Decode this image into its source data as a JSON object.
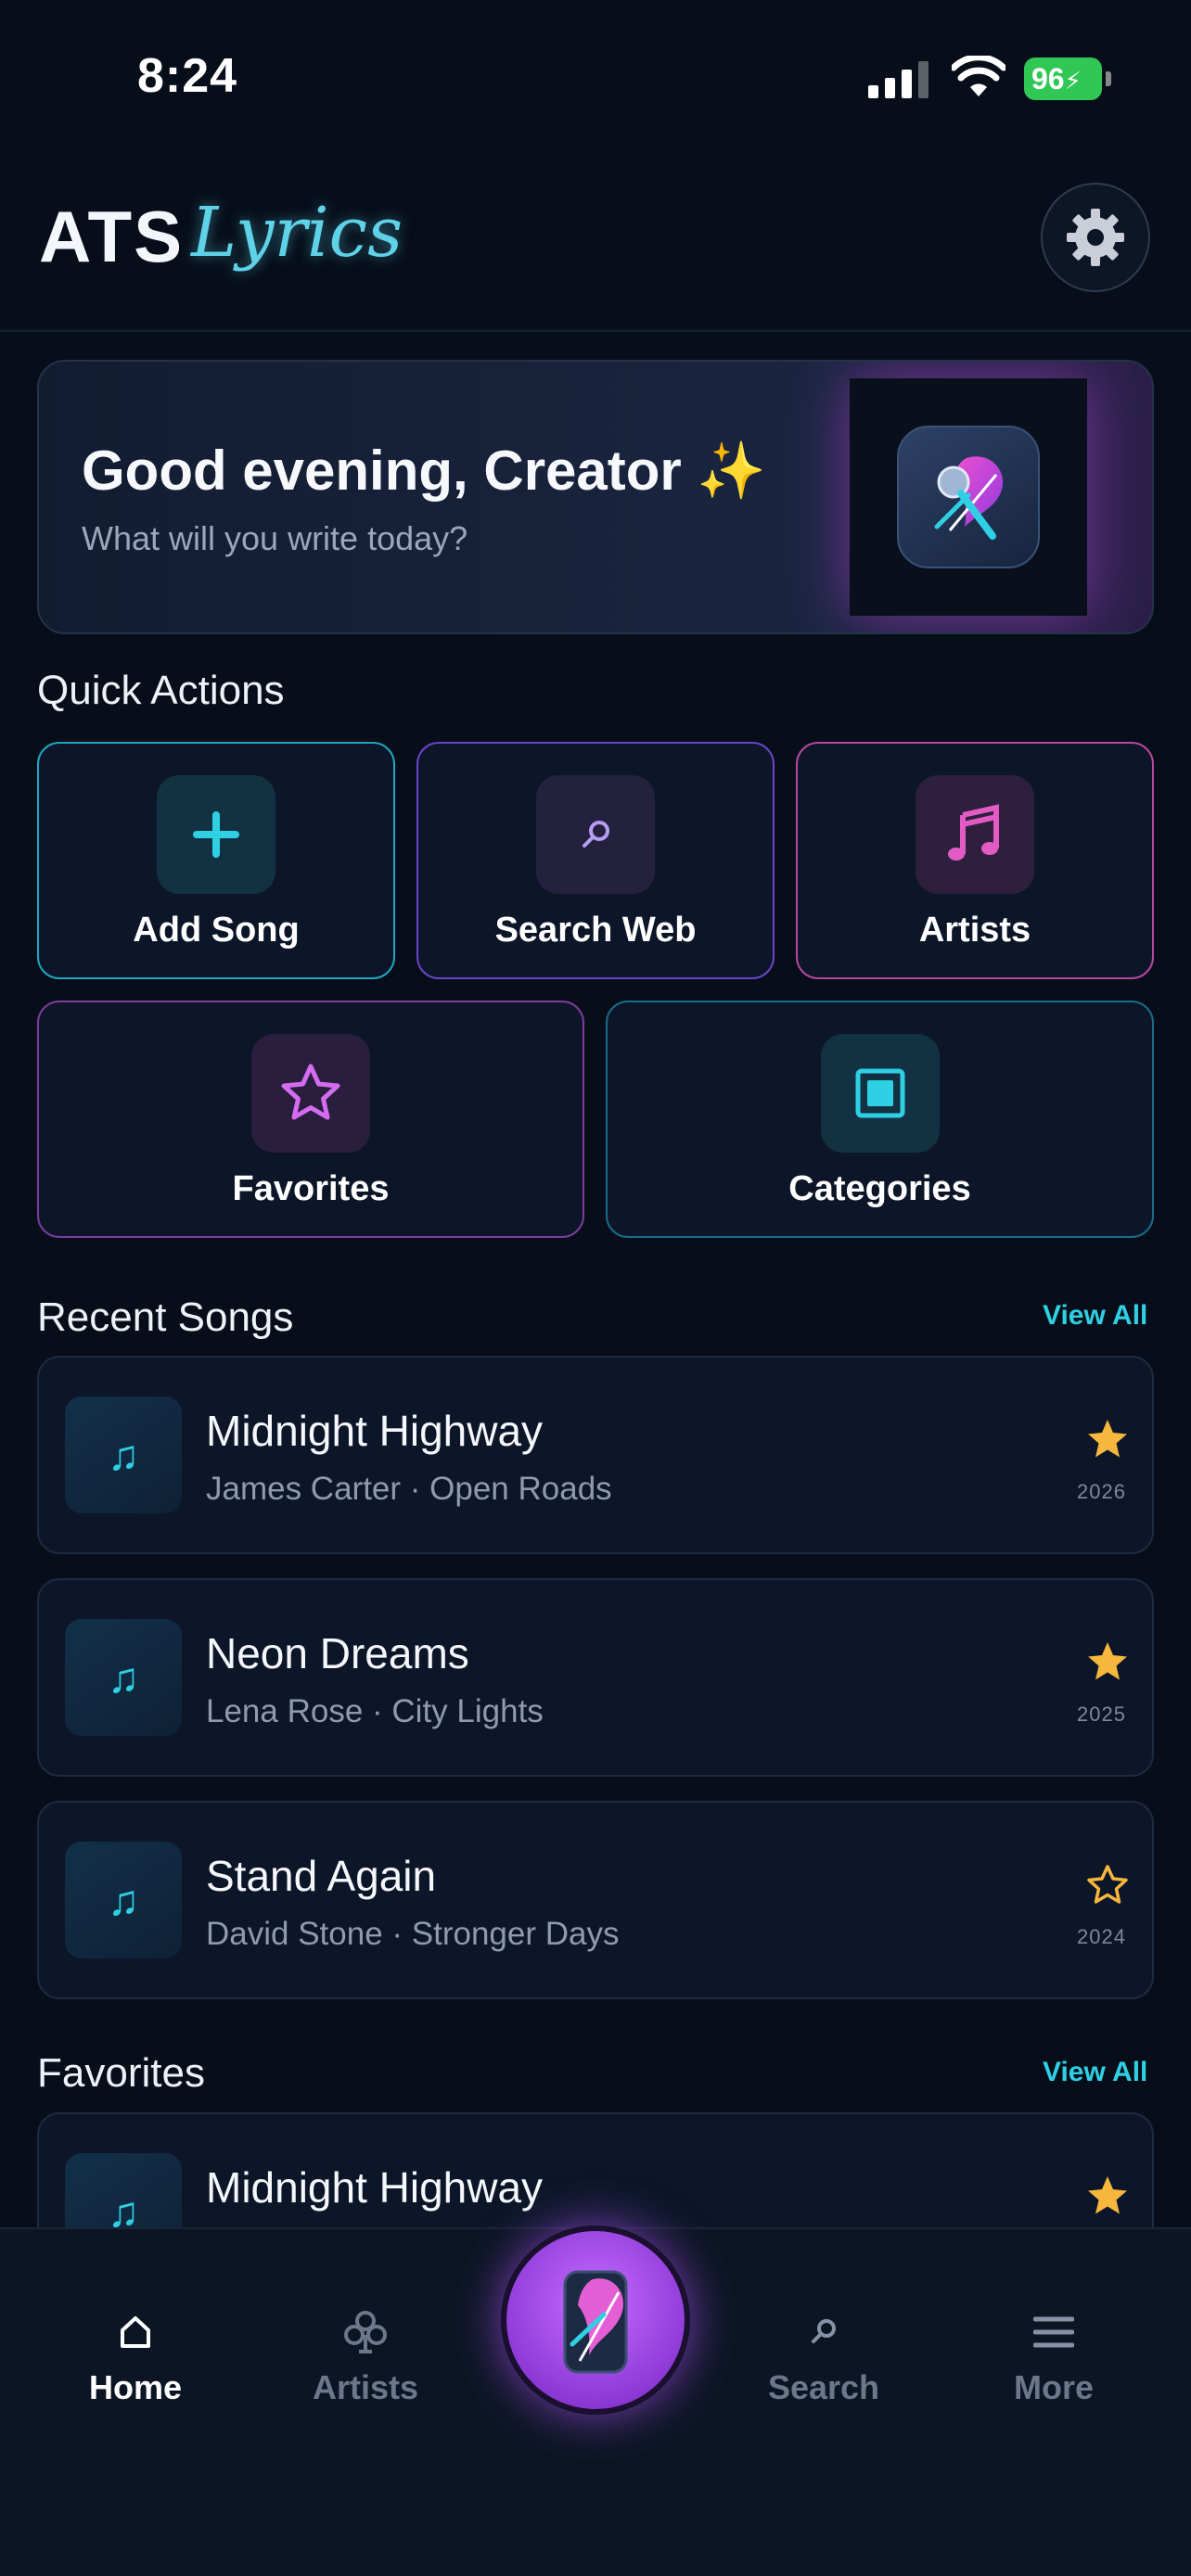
{
  "status_bar": {
    "time": "8:24",
    "battery": "96"
  },
  "header": {
    "logo_main": "ATS",
    "logo_script": "Lyrics"
  },
  "greeting": {
    "title": "Good evening, Creator ✨",
    "subtitle": "What will you write today?"
  },
  "quick_actions": {
    "title": "Quick Actions",
    "items": [
      {
        "label": "Add Song",
        "icon": "plus-icon",
        "color": "#2fd0e4"
      },
      {
        "label": "Search Web",
        "icon": "search-icon",
        "color": "#8b5cf6"
      },
      {
        "label": "Artists",
        "icon": "music-note-icon",
        "color": "#e25bc4"
      },
      {
        "label": "Favorites",
        "icon": "star-icon",
        "color": "#b45fe0"
      },
      {
        "label": "Categories",
        "icon": "square-icon",
        "color": "#2fb6d6"
      }
    ]
  },
  "recent_songs": {
    "title": "Recent Songs",
    "view_all": "View All",
    "items": [
      {
        "title": "Midnight Highway",
        "subtitle": "James Carter · Open Roads",
        "year": "2026",
        "favorite": true
      },
      {
        "title": "Neon Dreams",
        "subtitle": "Lena Rose · City Lights",
        "year": "2025",
        "favorite": true
      },
      {
        "title": "Stand Again",
        "subtitle": "David Stone · Stronger Days",
        "year": "2024",
        "favorite": false
      }
    ]
  },
  "favorites": {
    "title": "Favorites",
    "view_all": "View All",
    "items": [
      {
        "title": "Midnight Highway",
        "favorite": true
      }
    ]
  },
  "bottom_nav": {
    "items": [
      {
        "label": "Home",
        "icon": "home-icon",
        "active": true
      },
      {
        "label": "Artists",
        "icon": "club-icon",
        "active": false
      },
      {
        "label": "Search",
        "icon": "search-icon",
        "active": false
      },
      {
        "label": "More",
        "icon": "menu-icon",
        "active": false
      }
    ]
  },
  "colors": {
    "accent_cyan": "#2fd0e4",
    "accent_purple": "#8b5cf6",
    "accent_pink": "#e25bc4",
    "star": "#f6b73c",
    "background": "#070e1a"
  }
}
